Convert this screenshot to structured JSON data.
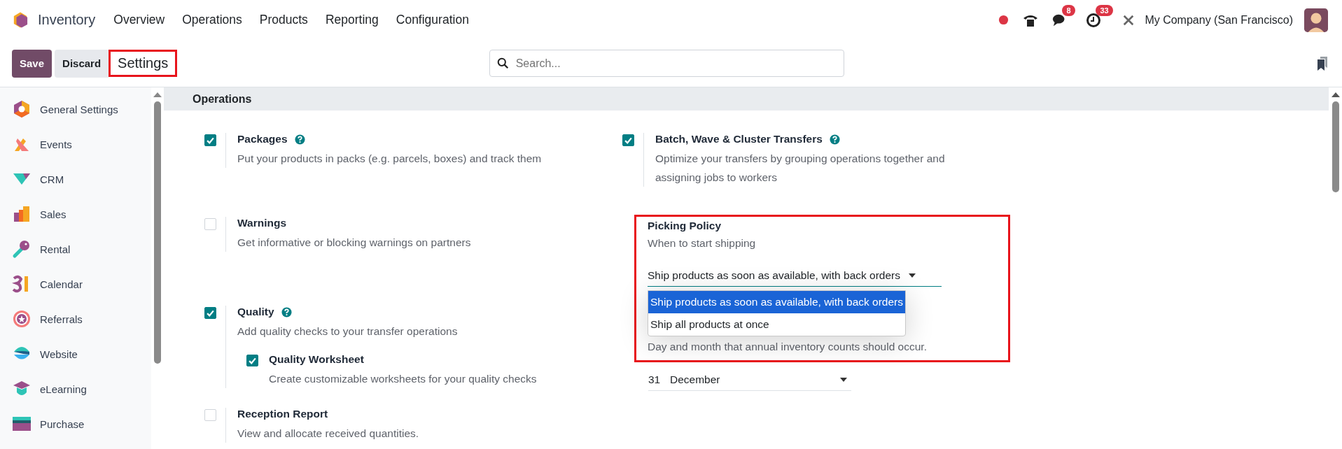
{
  "app": {
    "name": "Inventory",
    "menu": [
      "Overview",
      "Operations",
      "Products",
      "Reporting",
      "Configuration"
    ]
  },
  "systray": {
    "messages_badge": "8",
    "activities_badge": "33",
    "company": "My Company (San Francisco)"
  },
  "control_panel": {
    "buttons": [
      {
        "label": "Save",
        "kind": "primary"
      },
      {
        "label": "Discard",
        "kind": "secondary"
      }
    ],
    "breadcrumb": {
      "text": "Settings",
      "highlighted": true
    },
    "search": {
      "placeholder": "Search..."
    }
  },
  "sidebar": {
    "items": [
      {
        "label": "General Settings"
      },
      {
        "label": "Events"
      },
      {
        "label": "CRM"
      },
      {
        "label": "Sales"
      },
      {
        "label": "Rental"
      },
      {
        "label": "Calendar"
      },
      {
        "label": "Referrals"
      },
      {
        "label": "Website"
      },
      {
        "label": "eLearning"
      },
      {
        "label": "Purchase"
      }
    ]
  },
  "section": {
    "title": "Operations",
    "left": [
      {
        "title": "Packages",
        "help": true,
        "checked": true,
        "description": "Put your products in packs (e.g. parcels, boxes) and track them"
      },
      {
        "title": "Warnings",
        "help": false,
        "checked": false,
        "description": "Get informative or blocking warnings on partners"
      },
      {
        "title": "Quality",
        "help": true,
        "checked": true,
        "description": "Add quality checks to your transfer operations",
        "children": [
          {
            "title": "Quality Worksheet",
            "help": false,
            "checked": true,
            "description": "Create customizable worksheets for your quality checks"
          }
        ]
      },
      {
        "title": "Reception Report",
        "help": false,
        "checked": false,
        "description": "View and allocate received quantities."
      }
    ],
    "batch": {
      "title": "Batch, Wave & Cluster Transfers",
      "help": true,
      "checked": true,
      "description": "Optimize your transfers by grouping operations together and assigning jobs to workers"
    },
    "picking_policy": {
      "title": "Picking Policy",
      "description": "When to start shipping",
      "highlighted": true,
      "value": "Ship products as soon as available, with back orders",
      "expanded": true,
      "options": [
        {
          "label": "Ship products as soon as available, with back orders",
          "selected": true
        },
        {
          "label": "Ship all products at once",
          "selected": false
        }
      ]
    },
    "annual_inventory": {
      "description": "Day and month that annual inventory counts should occur.",
      "day": "31",
      "month": "December"
    }
  }
}
